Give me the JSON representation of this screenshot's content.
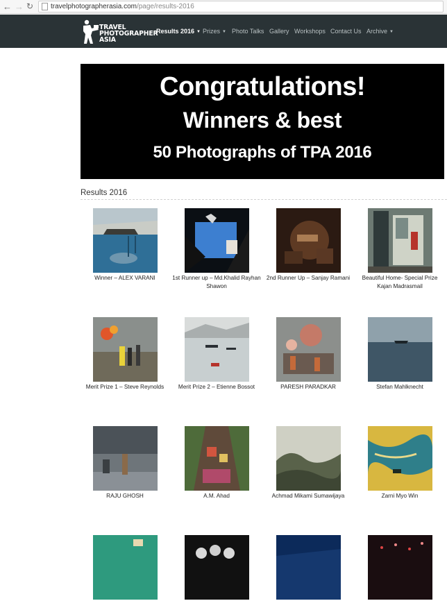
{
  "browser": {
    "back_icon": "arrow-left-icon",
    "forward_icon": "arrow-right-icon",
    "reload_icon": "reload-icon",
    "url_domain": "travelphotographerasia.com",
    "url_path": "/page/results-2016"
  },
  "nav": {
    "logo_line1": "TRAVEL",
    "logo_line2": "PHOTOGRAPHER",
    "logo_line3": "ASIA",
    "items": [
      {
        "label": "Results 2016",
        "caret": "▼",
        "active": true
      },
      {
        "label": "Prizes",
        "caret": "▼"
      },
      {
        "label": "Photo Talks"
      },
      {
        "label": "Gallery"
      },
      {
        "label": "Workshops"
      },
      {
        "label": "Contact Us"
      },
      {
        "label": "Archive",
        "caret": "▼"
      }
    ],
    "colors": {
      "background": "#2a3336",
      "active": "#ffffff",
      "inactive": "#b8c0c2"
    }
  },
  "banner": {
    "line1": "Congratulations!",
    "line2": "Winners & best",
    "line3": "50 Photographs of TPA 2016"
  },
  "section": {
    "title": "Results 2016"
  },
  "entries": [
    {
      "caption": "Winner – ALEX VARANI"
    },
    {
      "caption": "1st Runner up – Md.Khalid Rayhan Shawon"
    },
    {
      "caption": "2nd Runner Up – Sanjay Ramani"
    },
    {
      "caption": "Beautiful Home- Special Prize Kajan Madrasmail"
    },
    {
      "caption": "Merit Prize 1 – Steve Reynolds"
    },
    {
      "caption": "Merit Prize 2 – Etienne Bossot"
    },
    {
      "caption": "PARESH PARADKAR"
    },
    {
      "caption": "Stefan Mahlknecht"
    },
    {
      "caption": "RAJU GHOSH"
    },
    {
      "caption": "A.M. Ahad"
    },
    {
      "caption": "Achmad Mikami Sumawijaya"
    },
    {
      "caption": "Zarni Myo Win"
    },
    {
      "caption": ""
    },
    {
      "caption": ""
    },
    {
      "caption": ""
    },
    {
      "caption": ""
    }
  ]
}
